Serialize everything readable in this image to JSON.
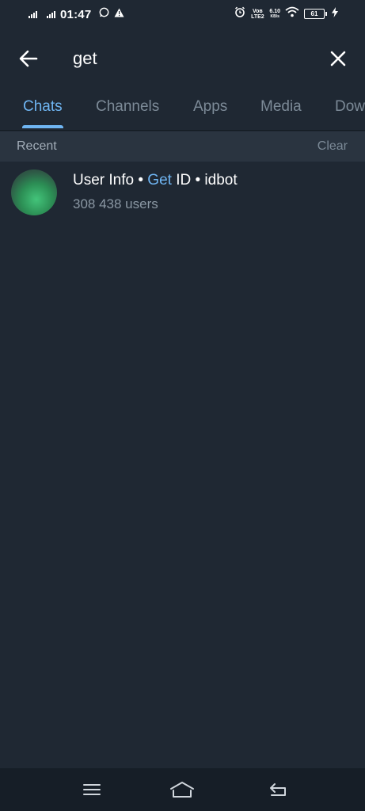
{
  "status_bar": {
    "time": "01:47",
    "volte_label": "Voʙ LTE2",
    "net_speed": "6.10",
    "net_unit": "KB/s",
    "battery": "61"
  },
  "search": {
    "value": "get"
  },
  "tabs": [
    {
      "label": "Chats",
      "active": true
    },
    {
      "label": "Channels",
      "active": false
    },
    {
      "label": "Apps",
      "active": false
    },
    {
      "label": "Media",
      "active": false
    },
    {
      "label": "Dow",
      "active": false
    }
  ],
  "recent": {
    "title": "Recent",
    "clear_label": "Clear"
  },
  "results": [
    {
      "title_before": "User Info • ",
      "title_highlight": "Get",
      "title_after": " ID • idbot",
      "subtitle": "308 438 users"
    }
  ],
  "icons": {
    "back": "back-arrow-icon",
    "close": "close-icon",
    "nav_menu": "menu-icon",
    "nav_home": "home-icon",
    "nav_back": "return-icon"
  },
  "colors": {
    "background": "#1f2833",
    "accent": "#6fb5f2",
    "header_band": "#2a3440",
    "muted_text": "#8a97a3"
  }
}
